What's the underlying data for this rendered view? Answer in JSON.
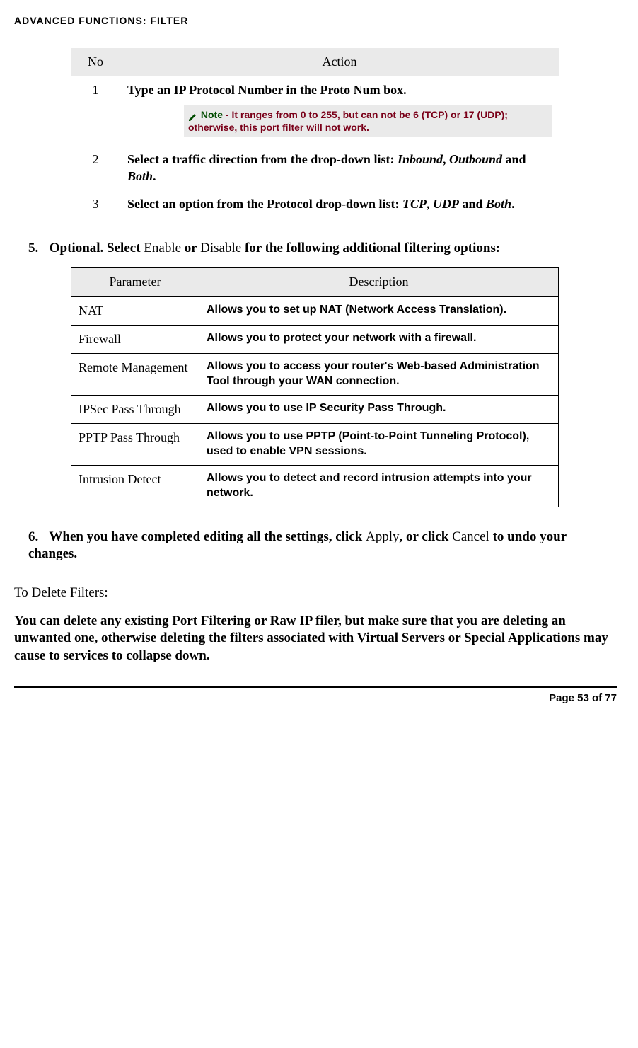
{
  "header": {
    "title": "ADVANCED FUNCTIONS: FILTER"
  },
  "table1": {
    "headers": {
      "no": "No",
      "action": "Action"
    },
    "rows": [
      {
        "no": "1",
        "action": "Type an IP Protocol Number in the Proto Num box.",
        "note_label": "Note",
        "note_body": " - It ranges from 0 to 255, but can not be 6 (TCP) or 17 (UDP); otherwise, this port filter will not work."
      },
      {
        "no": "2",
        "action_pre": "Select a traffic direction from the drop-down list: ",
        "em1": "Inbound",
        "sep1": ", ",
        "em2": "Outbound",
        "sep2": " and ",
        "em3": "Both",
        "tail": "."
      },
      {
        "no": "3",
        "action_pre": "Select an option from the Protocol drop-down list: ",
        "em1": "TCP",
        "sep1": ", ",
        "em2": "UDP",
        "sep2": " and ",
        "em3": "Both",
        "tail": "."
      }
    ]
  },
  "step5": {
    "num": "5.",
    "pre": "Optional. Select ",
    "opt1": "Enable",
    "mid": " or ",
    "opt2": "Disable",
    "post": " for the following additional filtering options:"
  },
  "table2": {
    "headers": {
      "param": "Parameter",
      "desc": "Description"
    },
    "rows": [
      {
        "param": "NAT",
        "desc": "Allows you to set up NAT (Network Access Translation)."
      },
      {
        "param": "Firewall",
        "desc": "Allows you to protect your network with a firewall."
      },
      {
        "param": "Remote Management",
        "desc": "Allows you to access your router's Web-based Administration Tool through your WAN connection."
      },
      {
        "param": "IPSec Pass Through",
        "desc": "Allows you to use IP Security Pass Through."
      },
      {
        "param": "PPTP Pass Through",
        "desc": "Allows you to use PPTP (Point-to-Point Tunneling Protocol), used to enable VPN sessions."
      },
      {
        "param": "Intrusion Detect",
        "desc": "Allows you to detect and record intrusion attempts into your network."
      }
    ]
  },
  "step6": {
    "num": "6.",
    "pre": "When you have completed editing all the settings, click ",
    "btn1": "Apply",
    "mid": ", or click ",
    "btn2": "Cancel",
    "post": " to undo your changes."
  },
  "subheading": "To Delete Filters:",
  "warning": "You can delete any existing Port Filtering or Raw IP filer, but make sure that you are deleting an unwanted one, otherwise deleting the filters associated with Virtual Servers or Special Applications may cause to services to collapse down.",
  "footer": "Page 53 of 77"
}
